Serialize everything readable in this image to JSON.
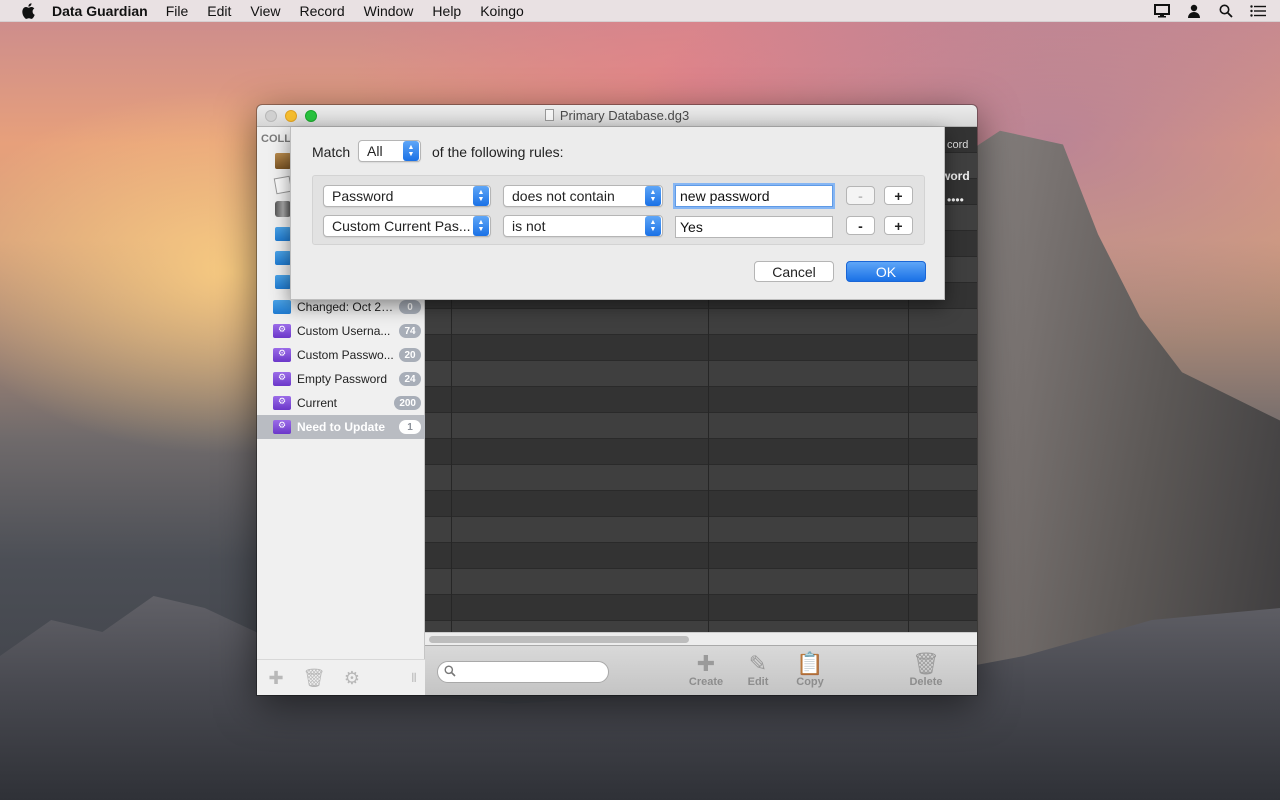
{
  "menubar": {
    "app_name": "Data Guardian",
    "items": [
      "File",
      "Edit",
      "View",
      "Record",
      "Window",
      "Help",
      "Koingo"
    ]
  },
  "window": {
    "title": "Primary Database.dg3"
  },
  "sidebar": {
    "header": "COLL",
    "items": [
      {
        "label": "Changed: Oct 25,...",
        "badge": "0",
        "color": "blue"
      },
      {
        "label": "Custom Userna...",
        "badge": "74",
        "color": "purple"
      },
      {
        "label": "Custom Passwo...",
        "badge": "20",
        "color": "purple"
      },
      {
        "label": "Empty Password",
        "badge": "24",
        "color": "purple"
      },
      {
        "label": "Current",
        "badge": "200",
        "color": "purple"
      },
      {
        "label": "Need to Update",
        "badge": "1",
        "color": "purple",
        "selected": true
      }
    ]
  },
  "table": {
    "header_peek_1": "cord",
    "header_peek_2": "word",
    "header_peek_3": "••••"
  },
  "toolbar": {
    "create": "Create",
    "edit": "Edit",
    "copy": "Copy",
    "delete": "Delete",
    "search_placeholder": ""
  },
  "sheet": {
    "match_label": "Match",
    "match_value": "All",
    "match_suffix": "of the following rules:",
    "rules": [
      {
        "field": "Password",
        "operator": "does not contain",
        "value": "new password",
        "minus": "-",
        "plus": "+"
      },
      {
        "field": "Custom Current Pas...",
        "operator": "is not",
        "value": "Yes",
        "minus": "-",
        "plus": "+"
      }
    ],
    "cancel": "Cancel",
    "ok": "OK"
  },
  "colors": {
    "accent": "#1a71e6",
    "badge": "#a8aeb8"
  }
}
